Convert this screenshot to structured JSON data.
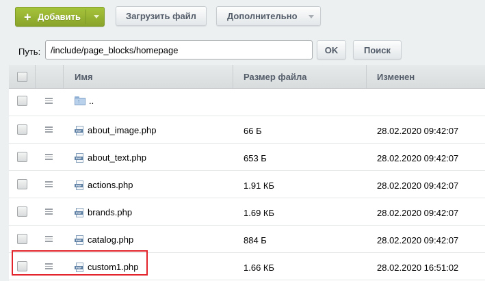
{
  "toolbar": {
    "add_label": "Добавить",
    "add_plus": "+",
    "upload_label": "Загрузить файл",
    "more_label": "Дополнительно"
  },
  "pathbar": {
    "label": "Путь:",
    "value": "/include/page_blocks/homepage",
    "ok_label": "OK",
    "search_label": "Поиск"
  },
  "table": {
    "columns": {
      "name": "Имя",
      "size": "Размер файла",
      "modified": "Изменен"
    },
    "parent": {
      "name": ".."
    },
    "rows": [
      {
        "name": "about_image.php",
        "size": "66 Б",
        "modified": "28.02.2020 09:42:07"
      },
      {
        "name": "about_text.php",
        "size": "653 Б",
        "modified": "28.02.2020 09:42:07"
      },
      {
        "name": "actions.php",
        "size": "1.91 КБ",
        "modified": "28.02.2020 09:42:07"
      },
      {
        "name": "brands.php",
        "size": "1.69 КБ",
        "modified": "28.02.2020 09:42:07"
      },
      {
        "name": "catalog.php",
        "size": "884 Б",
        "modified": "28.02.2020 09:42:07"
      },
      {
        "name": "custom1.php",
        "size": "1.66 КБ",
        "modified": "28.02.2020 16:51:02"
      }
    ]
  },
  "colors": {
    "accent_green": "#94b032",
    "highlight_red": "#e2242a"
  }
}
